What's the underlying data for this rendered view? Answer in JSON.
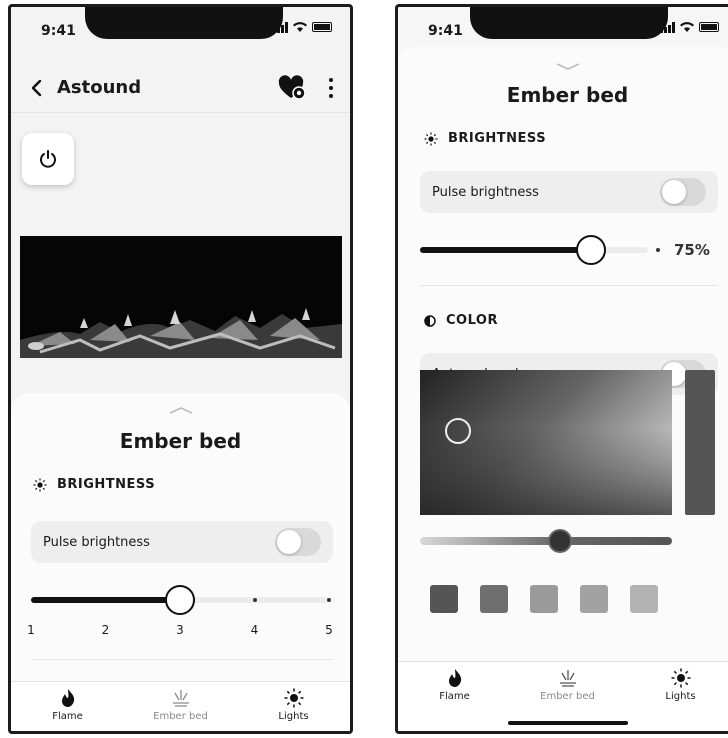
{
  "status_time": "9:41",
  "screen1": {
    "header": {
      "title": "Astound"
    },
    "sheet": {
      "title": "Ember bed",
      "brightness": {
        "section_label": "BRIGHTNESS",
        "pulse_label": "Pulse brightness",
        "pulse_on": false,
        "level": 3,
        "ticks": [
          "1",
          "2",
          "3",
          "4",
          "5"
        ]
      }
    },
    "tabs": [
      {
        "label": "Flame",
        "icon": "flame-icon",
        "active": true
      },
      {
        "label": "Ember bed",
        "icon": "ember-bed-icon",
        "active": false
      },
      {
        "label": "Lights",
        "icon": "sun-icon",
        "active": true
      }
    ]
  },
  "screen2": {
    "sheet": {
      "title": "Ember bed",
      "brightness": {
        "section_label": "BRIGHTNESS",
        "pulse_label": "Pulse brightness",
        "pulse_on": false,
        "value": 0.75,
        "value_label": "75%"
      },
      "color": {
        "section_label": "COLOR",
        "autocycle_label": "Autocycle colors",
        "autocycle_on": false,
        "swatches": [
          "#555555",
          "#6f6f6f",
          "#9a9a9a",
          "#a2a2a2",
          "#b3b3b3"
        ]
      }
    },
    "tabs": [
      {
        "label": "Flame",
        "icon": "flame-icon"
      },
      {
        "label": "Ember bed",
        "icon": "ember-bed-icon"
      },
      {
        "label": "Lights",
        "icon": "sun-icon"
      }
    ]
  }
}
